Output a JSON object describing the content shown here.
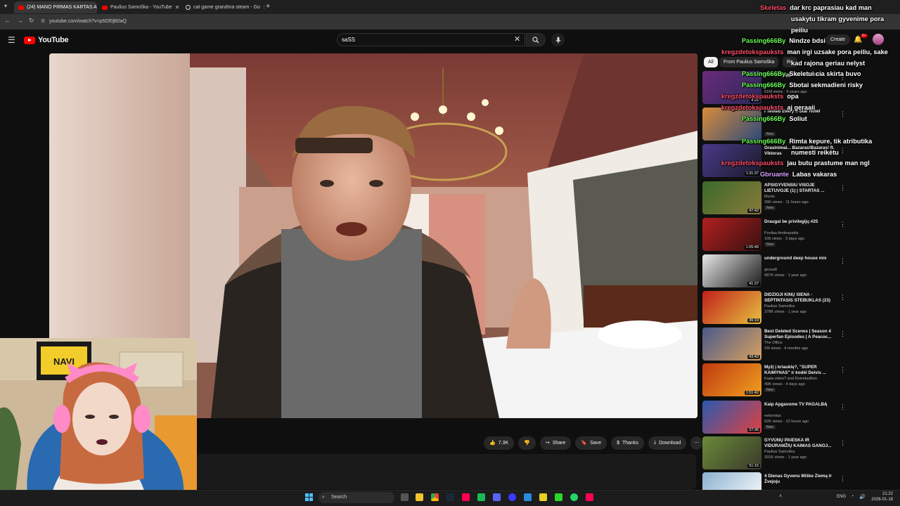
{
  "browser": {
    "tabs": [
      {
        "label": "(24) MANO PIRMAS KARTAS A",
        "active": true
      },
      {
        "label": "Paulius Samoška - YouTube",
        "active": false
      },
      {
        "label": "cat game grandma steam - Go",
        "active": false
      }
    ],
    "new_tab": "+",
    "url": "youtube.com/watch?v=p5Df0jB0aQ"
  },
  "youtube": {
    "logo": "YouTube",
    "search_value": "saSS",
    "create_label": "Create",
    "notif_count": "9+",
    "chips": [
      "All",
      "From Paulius Samoška",
      "Re"
    ],
    "actions": {
      "likes": "7.3K",
      "share": "Share",
      "save": "Save",
      "thanks": "Thanks",
      "download": "Download"
    },
    "recommendations": [
      {
        "title": "Snoop Dogg - Gin And Juice",
        "channel": "",
        "meta": "51M views · 9 years ago",
        "duration": "4:25",
        "badge": "",
        "thumb": [
          "#6b2a7a",
          "#2a2a5a"
        ]
      },
      {
        "title": "I Tested Every 1-Star Hotel",
        "channel": "",
        "meta": "",
        "duration": "",
        "badge": "New",
        "thumb": [
          "#d98c3a",
          "#2c4a7a"
        ]
      },
      {
        "title": "Grasinimai... Bazaras!Bazaras! ft. Viktoras",
        "channel": "",
        "meta": "",
        "duration": "1:31:37",
        "badge": "",
        "thumb": [
          "#4a3a8a",
          "#1a1a2a"
        ]
      },
      {
        "title": "APSIGYVENSIU VISOJE LIETUVOJE (1) | STARTAS ...",
        "channel": "Munis",
        "meta": "39K views · 11 hours ago",
        "duration": "47:42",
        "badge": "New",
        "thumb": [
          "#3a6a2a",
          "#8a7a3a"
        ]
      },
      {
        "title": "Draugai be privilegijų #25",
        "channel": "Povilas Ambrazaitis",
        "meta": "106 views · 3 days ago",
        "duration": "1:05:49",
        "badge": "New",
        "thumb": [
          "#b02020",
          "#3a1010"
        ]
      },
      {
        "title": "underground deep house mix",
        "channel": "gesus8",
        "meta": "687K views · 1 year ago",
        "duration": "41:37",
        "badge": "",
        "thumb": [
          "#e8e8e8",
          "#1a1a1a"
        ]
      },
      {
        "title": "DIDŽIOJI KINŲ SIENA - SEPTINTASIS STEBUKLAS (23)",
        "channel": "Paulius Samoška",
        "meta": "378K views · 1 year ago",
        "duration": "36:19",
        "badge": "",
        "thumb": [
          "#c0201a",
          "#e8c040"
        ]
      },
      {
        "title": "Best Deleted Scenes | Season 4 Superfan Episodes | A Peacoc...",
        "channel": "The Office",
        "meta": "1M views · 4 months ago",
        "duration": "43:42",
        "badge": "",
        "thumb": [
          "#4a5a8a",
          "#d8a060"
        ]
      },
      {
        "title": "Myžį į kriauklę?, \"SUPER KAIMYNAS\" ir kodėl Deivis ...",
        "channel": "Kada video? and DeividasBen",
        "meta": "49K views · 4 days ago",
        "duration": "1:51:42",
        "badge": "New",
        "thumb": [
          "#c03a10",
          "#f0a020"
        ]
      },
      {
        "title": "Kaip Apgavome TV PAGALBĄ",
        "channel": "nelivrnkai",
        "meta": "62K views · 12 hours ago",
        "duration": "27:36",
        "badge": "New",
        "thumb": [
          "#2a5ab0",
          "#e04040"
        ]
      },
      {
        "title": "GYVŪNŲ PAIEŠKA IR VIDURAMŽIŲ KAIMAS GANOJ...",
        "channel": "Paulius Samoška",
        "meta": "331K views · 1 year ago",
        "duration": "51:15",
        "badge": "",
        "thumb": [
          "#6a8a3a",
          "#3a3a2a"
        ]
      },
      {
        "title": "4 Dienas Gyvenu Miške Žiemą Ir Žvejoju",
        "channel": "",
        "meta": "",
        "duration": "",
        "badge": "",
        "thumb": [
          "#8ab0d0",
          "#ffffff"
        ]
      }
    ]
  },
  "chat": [
    {
      "user": "Skeletas",
      "msg": "dar krc paprasiau kad man",
      "color": "#ff4d6a"
    },
    {
      "user": "",
      "msg": "usakytu tikram gyvenime pora",
      "color": "#ffffff"
    },
    {
      "user": "",
      "msg": "peiliu",
      "color": "#ffffff"
    },
    {
      "user": "Passing666By",
      "msg": "Nindze bdsi",
      "color": "#6cff5a"
    },
    {
      "user": "kregzdetokspauksts",
      "msg": "man irgi uzsake pora peiliu, sake",
      "color": "#ff4d6a"
    },
    {
      "user": "",
      "msg": "kad rajona geriau nelyst",
      "color": "#ffffff"
    },
    {
      "user": "Passing666By",
      "msg": "Skeletui cia skirta buvo",
      "color": "#6cff5a"
    },
    {
      "user": "Passing666By",
      "msg": "Sbotai sekmadieni risky",
      "color": "#6cff5a"
    },
    {
      "user": "kregzdetokspauksts",
      "msg": "opa",
      "color": "#ff4d6a"
    },
    {
      "user": "kregzdetokspauksts",
      "msg": "aj geraaii",
      "color": "#ff4d6a"
    },
    {
      "user": "Passing666By",
      "msg": "Soliut",
      "color": "#6cff5a"
    },
    {
      "user": "Passing666By",
      "msg": "Rimta kepure, tik atributika",
      "color": "#6cff5a"
    },
    {
      "user": "",
      "msg": "numesti reikėtu",
      "color": "#ffffff"
    },
    {
      "user": "kregzdetokspauksts",
      "msg": "jau butu prastume man ngl",
      "color": "#ff4d6a"
    },
    {
      "user": "Gbruante",
      "msg": "Labas vakaras",
      "color": "#d8a0ff"
    }
  ],
  "taskbar": {
    "search": "Search",
    "lang": "ENG",
    "time": "21:22",
    "date": "2026-01-18"
  }
}
